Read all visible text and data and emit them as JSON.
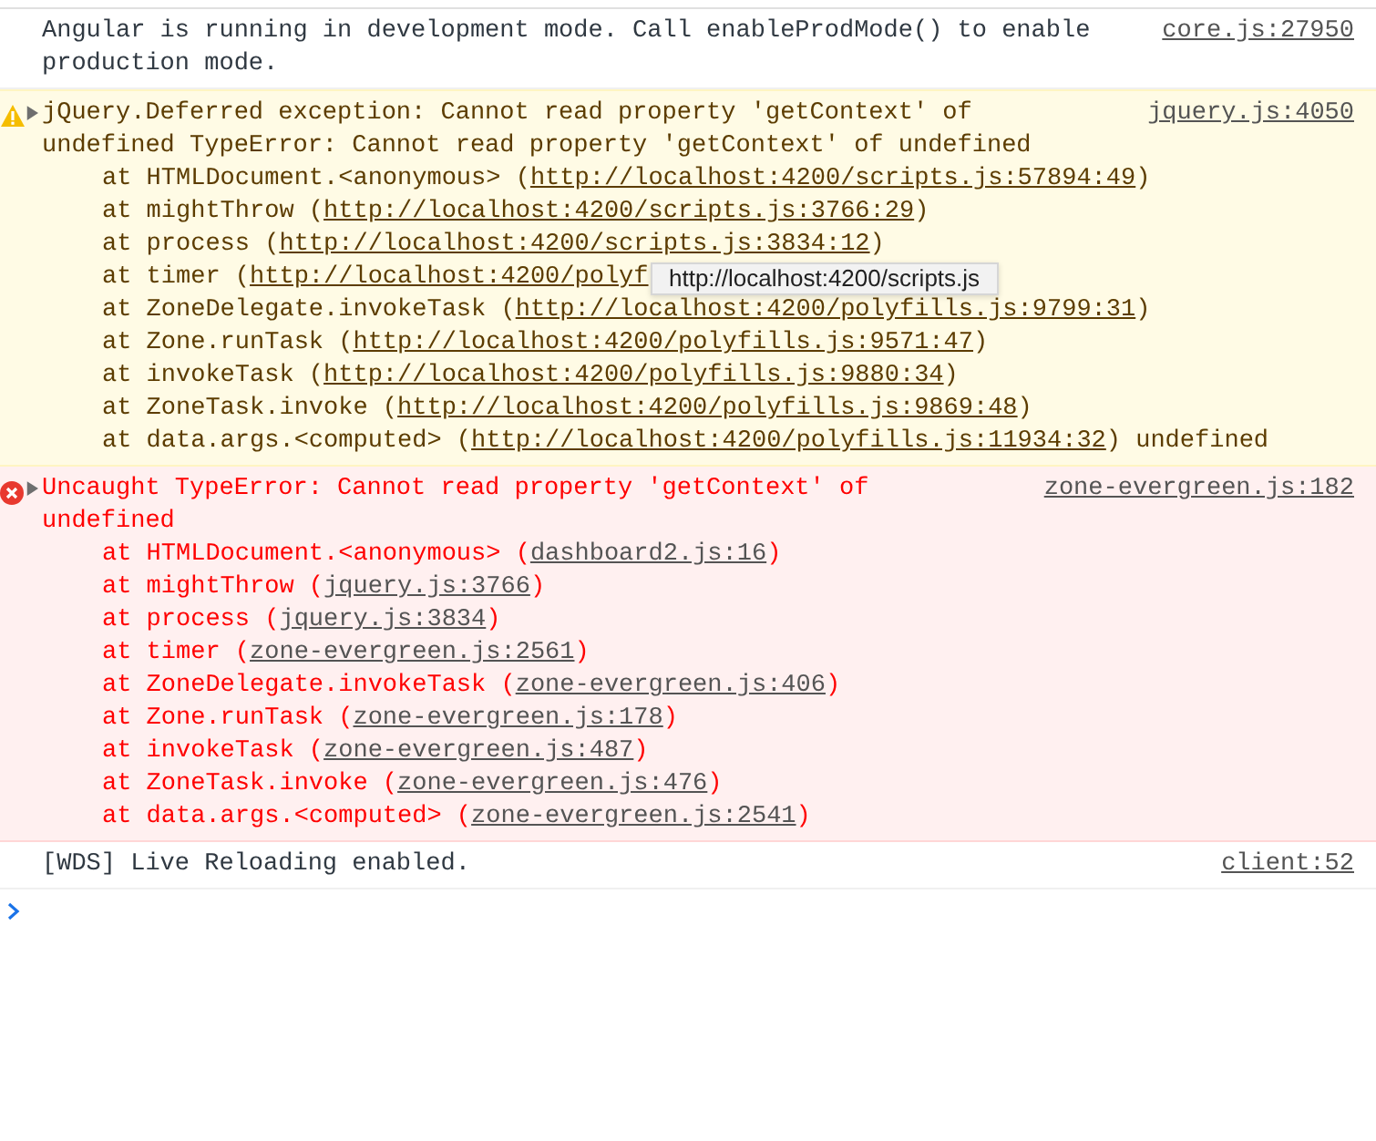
{
  "console": {
    "messages": [
      {
        "kind": "log",
        "text": "Angular is running in development mode. Call enableProdMode() to enable production mode.",
        "source": "core.js:27950"
      },
      {
        "kind": "warning",
        "expanded": false,
        "text": "jQuery.Deferred exception: Cannot read property 'getContext' of undefined TypeError: Cannot read property 'getContext' of undefined",
        "source": "jquery.js:4050",
        "stack": [
          {
            "prefix": "at HTMLDocument.<anonymous> (",
            "link": "http://localhost:4200/scripts.js:57894:49",
            "suffix": ")"
          },
          {
            "prefix": "at mightThrow (",
            "link": "http://localhost:4200/scripts.js:3766:29",
            "suffix": ")"
          },
          {
            "prefix": "at process (",
            "link": "http://localhost:4200/scripts.js:3834:12",
            "suffix": ")"
          },
          {
            "prefix": "at timer (",
            "link": "http://localhost:4200/polyf"
          },
          {
            "prefix": "at ZoneDelegate.invokeTask (",
            "link": "http://localhost:4200/polyfills.js:9799:31",
            "suffix": ")"
          },
          {
            "prefix": "at Zone.runTask (",
            "link": "http://localhost:4200/polyfills.js:9571:47",
            "suffix": ")"
          },
          {
            "prefix": "at invokeTask (",
            "link": "http://localhost:4200/polyfills.js:9880:34",
            "suffix": ")"
          },
          {
            "prefix": "at ZoneTask.invoke (",
            "link": "http://localhost:4200/polyfills.js:9869:48",
            "suffix": ")"
          },
          {
            "prefix": "at data.args.<computed> (",
            "link": "http://localhost:4200/polyfills.js:11934:32",
            "suffix": ") undefined"
          }
        ],
        "tooltip": "http://localhost:4200/scripts.js"
      },
      {
        "kind": "error",
        "expanded": false,
        "text": "Uncaught TypeError: Cannot read property 'getContext' of undefined",
        "source": "zone-evergreen.js:182",
        "stack": [
          {
            "prefix": "at HTMLDocument.<anonymous> (",
            "link": "dashboard2.js:16",
            "suffix": ")"
          },
          {
            "prefix": "at mightThrow (",
            "link": "jquery.js:3766",
            "suffix": ")"
          },
          {
            "prefix": "at process (",
            "link": "jquery.js:3834",
            "suffix": ")"
          },
          {
            "prefix": "at timer (",
            "link": "zone-evergreen.js:2561",
            "suffix": ")"
          },
          {
            "prefix": "at ZoneDelegate.invokeTask (",
            "link": "zone-evergreen.js:406",
            "suffix": ")"
          },
          {
            "prefix": "at Zone.runTask (",
            "link": "zone-evergreen.js:178",
            "suffix": ")"
          },
          {
            "prefix": "at invokeTask (",
            "link": "zone-evergreen.js:487",
            "suffix": ")"
          },
          {
            "prefix": "at ZoneTask.invoke (",
            "link": "zone-evergreen.js:476",
            "suffix": ")"
          },
          {
            "prefix": "at data.args.<computed> (",
            "link": "zone-evergreen.js:2541",
            "suffix": ")"
          }
        ]
      },
      {
        "kind": "log",
        "text": "[WDS] Live Reloading enabled.",
        "source": "client:52"
      }
    ]
  }
}
